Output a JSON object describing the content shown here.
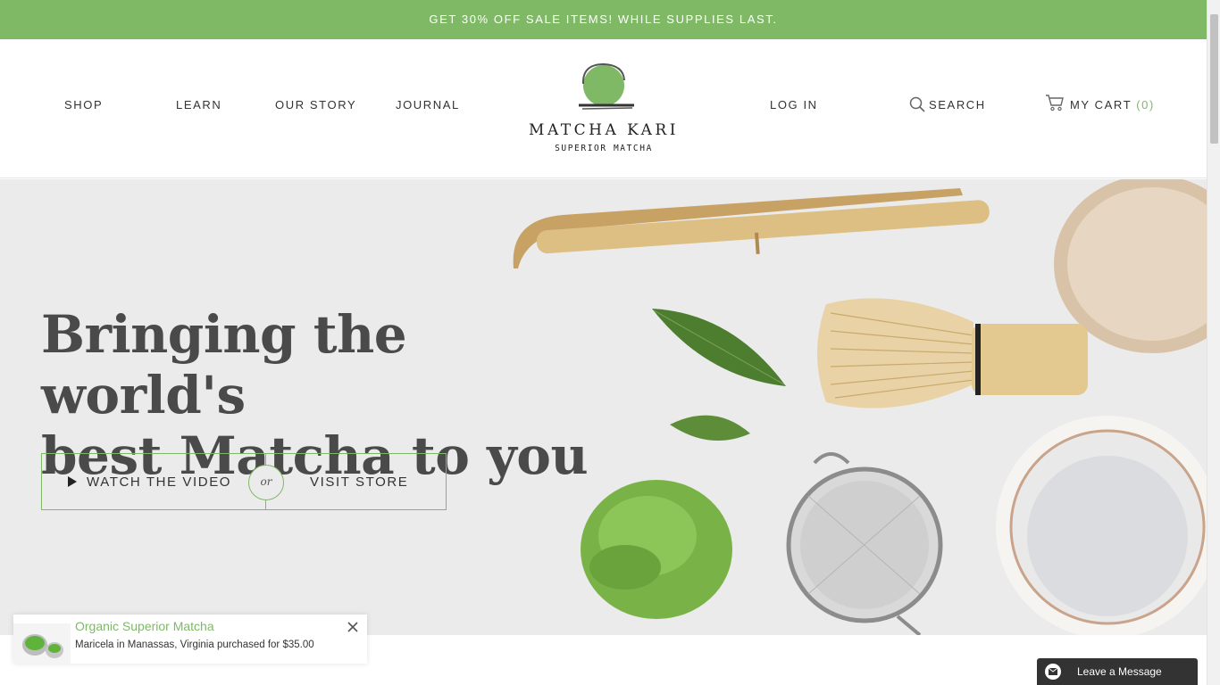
{
  "promo": {
    "text": "GET 30% OFF SALE ITEMS! WHILE SUPPLIES LAST."
  },
  "nav": {
    "shop": "SHOP",
    "learn": "LEARN",
    "our_story": "OUR STORY",
    "journal": "JOURNAL",
    "log_in": "LOG IN",
    "search": "SEARCH",
    "cart_label": "MY CART",
    "cart_count": "(0)"
  },
  "logo": {
    "name": "MATCHA KARI",
    "tagline": "SUPERIOR MATCHA"
  },
  "hero": {
    "headline_line1": "Bringing the world's",
    "headline_line2": "best Matcha to you",
    "watch_video": "WATCH THE VIDEO",
    "or": "or",
    "visit_store": "VISIT STORE"
  },
  "popup": {
    "title": "Organic Superior Matcha",
    "text": "Maricela in Manassas, Virginia purchased for $35.00"
  },
  "chat": {
    "label": "Leave a Message"
  },
  "colors": {
    "accent": "#7fb966",
    "headline": "#4a4a4a",
    "hero_bg": "#ebebeb"
  },
  "icons": [
    "search-icon",
    "cart-icon",
    "play-icon",
    "close-icon",
    "envelope-icon"
  ]
}
